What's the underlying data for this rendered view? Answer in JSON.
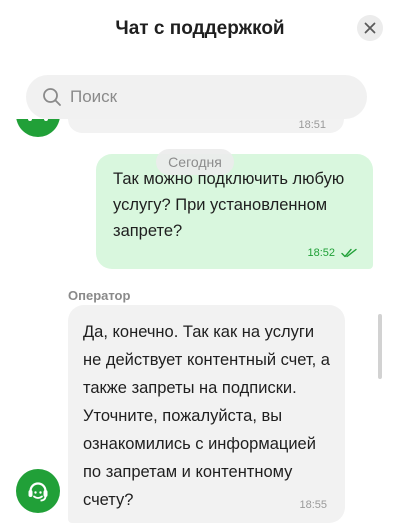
{
  "header": {
    "title": "Чат с поддержкой",
    "close_icon": "close-icon"
  },
  "search": {
    "placeholder": "Поиск",
    "value": "",
    "icon": "search-icon"
  },
  "chat": {
    "previous_message": {
      "time": "18:51"
    },
    "date_separator": "Сегодня",
    "outgoing_message": {
      "text": "Так можно подключить любую услугу? При установленном запрете?",
      "time": "18:52",
      "status_icon": "double-check-icon"
    },
    "incoming_message": {
      "sender": "Оператор",
      "text": "Да, конечно. Так как на услуги не действует контентный счет, а также запреты на подписки. Уточните, пожалуйста, вы ознакомились с информацией по запретам и контентному счету?",
      "time": "18:55"
    },
    "operator_avatar_icon": "support-agent-icon"
  },
  "colors": {
    "brand_green": "#21a038",
    "outgoing_bubble": "#d9f7de",
    "incoming_bubble": "#f2f2f2"
  }
}
